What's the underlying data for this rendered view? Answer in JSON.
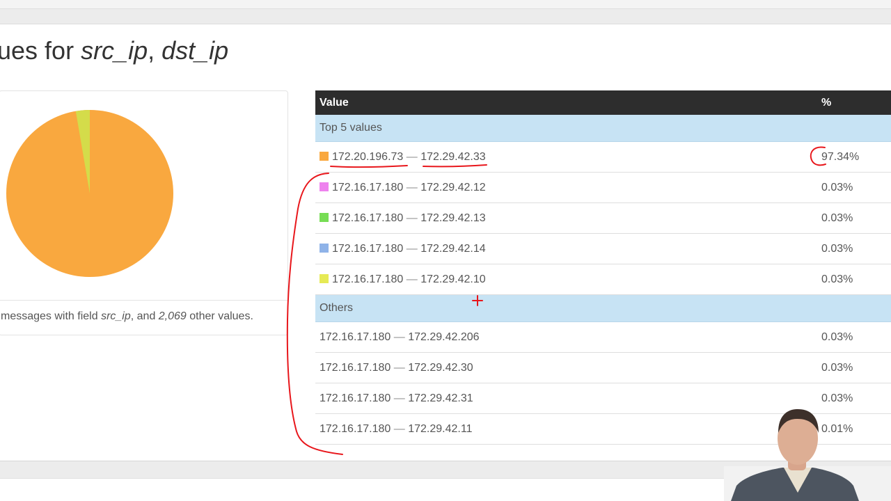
{
  "page": {
    "title_prefix": "ues for ",
    "title_field1": "src_ip",
    "title_sep": ", ",
    "title_field2": "dst_ip"
  },
  "pie": {
    "footer_prefix": "messages with field ",
    "footer_field": "src_ip",
    "footer_mid": ", and ",
    "footer_count": "2,069",
    "footer_suffix": " other values."
  },
  "table": {
    "col_value": "Value",
    "col_percent": "%",
    "top_group_label": "Top 5 values",
    "others_group_label": "Others",
    "top_rows": [
      {
        "src": "172.20.196.73",
        "dst": "172.29.42.33",
        "pct": "97.34%",
        "color": "#f9a83f"
      },
      {
        "src": "172.16.17.180",
        "dst": "172.29.42.12",
        "pct": "0.03%",
        "color": "#ee82ee"
      },
      {
        "src": "172.16.17.180",
        "dst": "172.29.42.13",
        "pct": "0.03%",
        "color": "#77dd55"
      },
      {
        "src": "172.16.17.180",
        "dst": "172.29.42.14",
        "pct": "0.03%",
        "color": "#8fb3e8"
      },
      {
        "src": "172.16.17.180",
        "dst": "172.29.42.10",
        "pct": "0.03%",
        "color": "#e6ea55"
      }
    ],
    "other_rows": [
      {
        "src": "172.16.17.180",
        "dst": "172.29.42.206",
        "pct": "0.03%"
      },
      {
        "src": "172.16.17.180",
        "dst": "172.29.42.30",
        "pct": "0.03%"
      },
      {
        "src": "172.16.17.180",
        "dst": "172.29.42.31",
        "pct": "0.03%"
      },
      {
        "src": "172.16.17.180",
        "dst": "172.29.42.11",
        "pct": "0.01%"
      }
    ],
    "dash": "—"
  },
  "colors": {
    "header_bg": "#2d2d2d",
    "group_bg": "#c7e3f4",
    "pie_main": "#f9a83f",
    "pie_minor": "#d4dc4a",
    "annotation_red": "#e8161b"
  }
}
